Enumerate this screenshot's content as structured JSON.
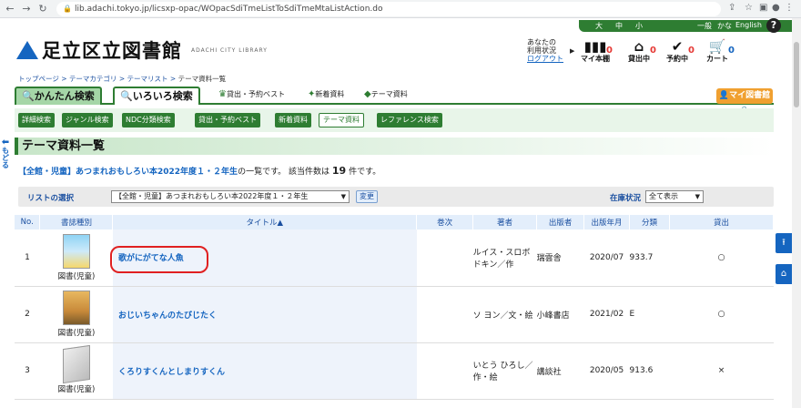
{
  "browser": {
    "url": "lib.adachi.tokyo.jp/licsxp-opac/WOpacSdiTmeListToSdiTmeMtaListAction.do"
  },
  "topbar": {
    "size_large": "大",
    "size_mid": "中",
    "size_small": "小",
    "mode_general": "一般",
    "mode_kana": "かな",
    "mode_english": "English",
    "help": "?"
  },
  "site": {
    "title": "足立区立図書館",
    "subtitle": "ADACHI CITY LIBRARY"
  },
  "user": {
    "line1": "あなたの",
    "line2": "利用状況",
    "logout": "ログアウト",
    "bookshelf": {
      "label": "マイ本棚",
      "count": "0"
    },
    "lending": {
      "label": "貸出中",
      "count": "0"
    },
    "reserved": {
      "label": "予約中",
      "count": "0"
    },
    "cart": {
      "label": "カート",
      "count": "0"
    }
  },
  "breadcrumb": {
    "top": "トップページ",
    "sep": ">",
    "category": "テーマカテゴリ",
    "list": "テーマリスト",
    "current": "テーマ資料一覧"
  },
  "tabs": {
    "simple": "かんたん検索",
    "various": "いろいろ検索",
    "best": "貸出・予約ベスト",
    "new": "新着資料",
    "theme": "テーマ資料",
    "mylib": "マイ図書館"
  },
  "subnav": [
    "詳細検索",
    "ジャンル検索",
    "NDC分類検索",
    "貸出・予約ベスト",
    "新着資料",
    "テーマ資料",
    "レファレンス検索"
  ],
  "back": "もどる",
  "heading": "テーマ資料一覧",
  "desc": {
    "theme": "【全館・児童】あつまれおもしろい本2022年度１・２年生",
    "suffix": "の一覧です。 該当件数は",
    "count": "19",
    "unit": "件です。"
  },
  "listbar": {
    "label": "リストの選択",
    "selected": "【全館・児童】あつまれおもしろい本2022年度１・２年生",
    "change": "変更",
    "stock_label": "在庫状況",
    "stock_selected": "全て表示"
  },
  "table": {
    "headers": [
      "No.",
      "書誌種別",
      "タイトル▲",
      "巻次",
      "著者",
      "出版者",
      "出版年月",
      "分類",
      "貸出"
    ],
    "rows": [
      {
        "no": "1",
        "type": "図書(児童)",
        "title": "歌がにがてな人魚",
        "vol": "",
        "author": "ルイス・スロボドキン／作",
        "publisher": "瑞雲舎",
        "date": "2020/07",
        "class": "933.7",
        "loan": "○"
      },
      {
        "no": "2",
        "type": "図書(児童)",
        "title": "おじいちゃんのたびじたく",
        "vol": "",
        "author": "ソ ヨン／文・絵",
        "publisher": "小峰書店",
        "date": "2021/02",
        "class": "E",
        "loan": "○"
      },
      {
        "no": "3",
        "type": "図書(児童)",
        "title": "くろりすくんとしまりすくん",
        "vol": "",
        "author": "いとう ひろし／作・絵",
        "publisher": "講談社",
        "date": "2020/05",
        "class": "913.6",
        "loan": "×"
      }
    ]
  },
  "colors": {
    "green": "#2e7d32",
    "blue": "#1565c0",
    "highlight": "#e02020"
  }
}
